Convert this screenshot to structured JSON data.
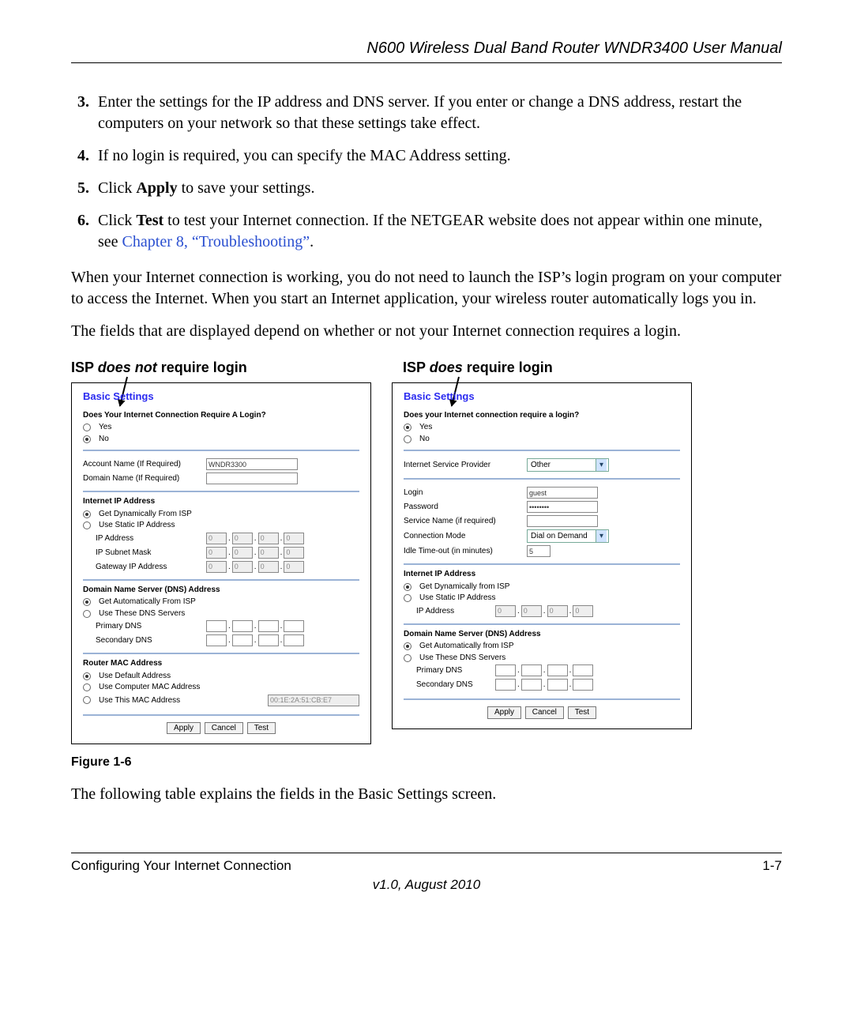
{
  "header": {
    "title": "N600 Wireless Dual Band Router WNDR3400 User Manual"
  },
  "steps": {
    "start": 3,
    "items": [
      {
        "text": "Enter the settings for the IP address and DNS server. If you enter or change a DNS address, restart the computers on your network so that these settings take effect."
      },
      {
        "text": "If no login is required, you can specify the MAC Address setting."
      },
      {
        "pre": "Click ",
        "bold": "Apply",
        "post": " to save your settings."
      },
      {
        "pre": "Click ",
        "bold": "Test",
        "mid": " to test your Internet connection. If the NETGEAR website does not appear within one minute, see ",
        "link": "Chapter 8, “Troubleshooting”",
        "post": "."
      }
    ]
  },
  "paragraphs": {
    "p1": "When your Internet connection is working, you do not need to launch the ISP’s login program on your computer to access the Internet. When you start an Internet application, your wireless router automatically logs you in.",
    "p2": "The fields that are displayed depend on whether or not your Internet connection requires a login."
  },
  "columns": {
    "left_caption_pre": "ISP ",
    "left_caption_em": "does not",
    "left_caption_post": " require login",
    "right_caption_pre": "ISP ",
    "right_caption_em": "does",
    "right_caption_post": " require login"
  },
  "left_panel": {
    "title": "Basic Settings",
    "q": "Does Your Internet Connection Require A Login?",
    "yes": "Yes",
    "no": "No",
    "account_label": "Account Name  (If Required)",
    "account_value": "WNDR3300",
    "domain_label": "Domain Name  (If Required)",
    "ip_section": "Internet IP Address",
    "ip_dyn": "Get Dynamically From ISP",
    "ip_static": "Use Static IP Address",
    "ip_addr": "IP Address",
    "ip_mask": "IP Subnet Mask",
    "ip_gw": "Gateway IP Address",
    "oct": "0",
    "dns_section": "Domain Name Server (DNS) Address",
    "dns_auto": "Get Automatically From ISP",
    "dns_use": "Use These DNS Servers",
    "dns_primary": "Primary DNS",
    "dns_secondary": "Secondary DNS",
    "mac_section": "Router MAC Address",
    "mac_default": "Use Default Address",
    "mac_computer": "Use Computer MAC Address",
    "mac_this": "Use This MAC Address",
    "mac_value": "00:1E:2A:51:CB:E7",
    "btn_apply": "Apply",
    "btn_cancel": "Cancel",
    "btn_test": "Test"
  },
  "right_panel": {
    "title": "Basic Settings",
    "q": "Does your Internet connection require a login?",
    "yes": "Yes",
    "no": "No",
    "isp_label": "Internet Service Provider",
    "isp_value": "Other",
    "login_label": "Login",
    "login_value": "guest",
    "password_label": "Password",
    "service_label": "Service Name (if required)",
    "mode_label": "Connection Mode",
    "mode_value": "Dial on Demand",
    "idle_label": "Idle Time-out (in minutes)",
    "idle_value": "5",
    "ip_section": "Internet IP Address",
    "ip_dyn": "Get Dynamically from ISP",
    "ip_static": "Use Static IP Address",
    "ip_addr": "IP Address",
    "oct": "0",
    "dns_section": "Domain Name Server (DNS) Address",
    "dns_auto": "Get Automatically from ISP",
    "dns_use": "Use These DNS Servers",
    "dns_primary": "Primary DNS",
    "dns_secondary": "Secondary DNS",
    "btn_apply": "Apply",
    "btn_cancel": "Cancel",
    "btn_test": "Test"
  },
  "figure_label": "Figure 1-6",
  "after_figure": "The following table explains the fields in the Basic Settings screen.",
  "footer": {
    "left": "Configuring Your Internet Connection",
    "right": "1-7",
    "version": "v1.0, August 2010"
  }
}
